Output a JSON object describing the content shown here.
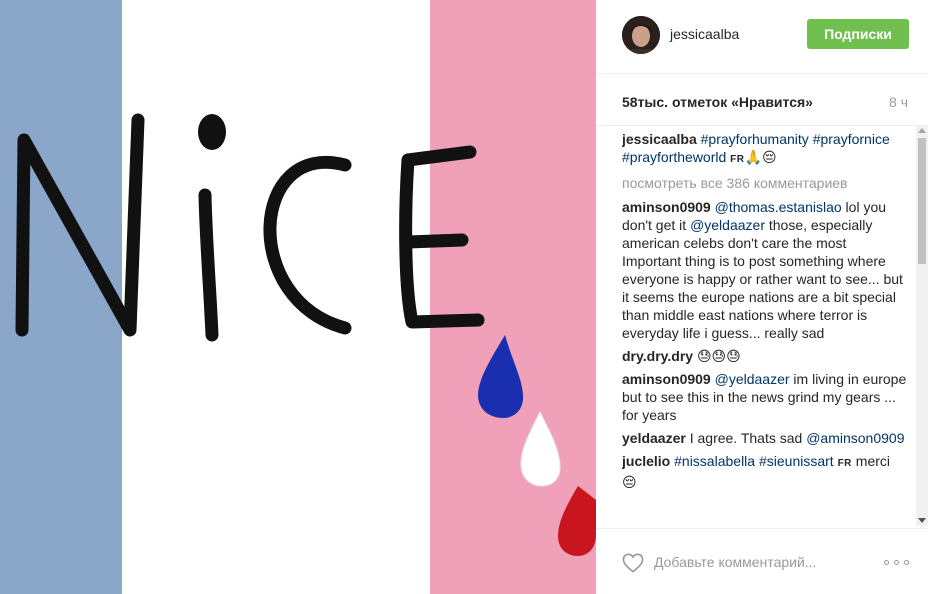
{
  "post": {
    "image": {
      "word": "NiCE"
    },
    "header": {
      "username": "jessicaalba",
      "follow_label": "Подписки"
    },
    "likes": {
      "text": "58тыс. отметок «Нравится»",
      "time": "8 ч"
    },
    "caption": {
      "author": "jessicaalba",
      "tags": [
        "#prayforhumanity",
        "#prayfornice",
        "#prayfortheworld"
      ],
      "flag": "FR",
      "emoji": "🙏😔"
    },
    "view_all": "посмотреть все 386 комментариев",
    "comments": [
      {
        "author": "aminson0909",
        "mention1": "@thomas.estanislao",
        "text1": " lol you don't get it ",
        "mention2": "@yeldaazer",
        "text2": " those, especially american celebs don't care the most Important thing is to post something where everyone is happy or rather want to see... but it seems the europe nations are a bit special than middle east nations where terror is everyday life i guess... really sad"
      },
      {
        "author": "dry.dry.dry",
        "text": "😓😓😓"
      },
      {
        "author": "aminson0909",
        "mention": "@yeldaazer",
        "text": " im living in europe but to see this in the news grind my gears ... for years"
      },
      {
        "author": "yeldaazer",
        "text": "I agree. Thats sad ",
        "mention": "@aminson0909"
      },
      {
        "author": "juclelio",
        "tags": [
          "#nissalabella",
          "#sieunissart"
        ],
        "flag": "FR",
        "text": "merci 😔"
      }
    ],
    "footer": {
      "comment_placeholder": "Добавьте комментарий..."
    }
  },
  "colors": {
    "flag_blue": "#8aa6c8",
    "flag_pink": "#f0a0b8",
    "follow_green": "#70c050",
    "link": "#003569",
    "muted": "#999999",
    "tear_blue": "#1a2fb0",
    "tear_red": "#c8151e"
  },
  "icons": [
    "heart-icon",
    "more-options-icon",
    "avatar"
  ]
}
